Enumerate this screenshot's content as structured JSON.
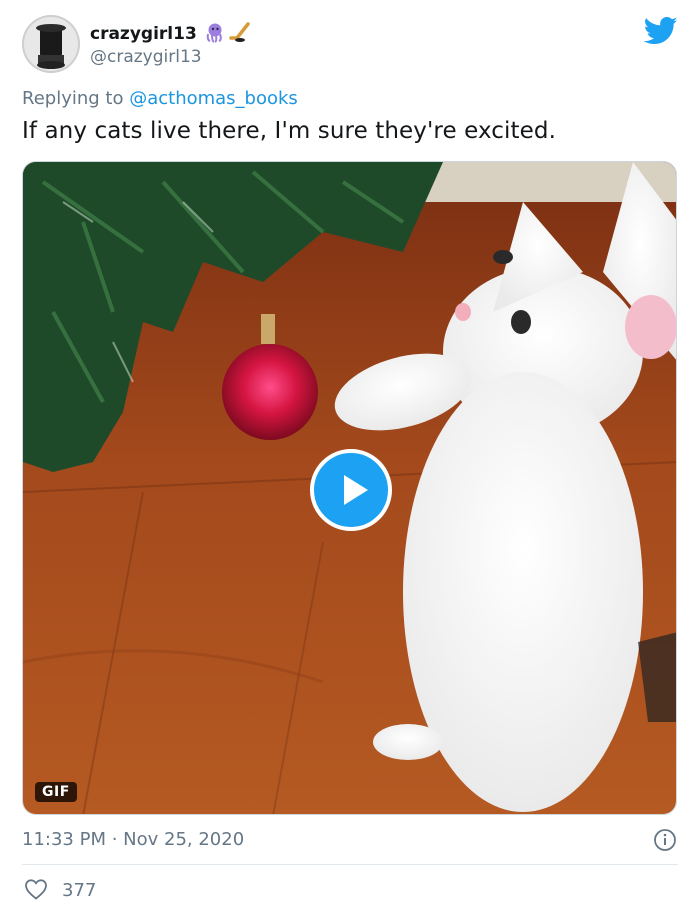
{
  "tweet": {
    "display_name": "crazygirl13",
    "handle": "@crazygirl13",
    "replying_prefix": "Replying to ",
    "replying_to": "@acthomas_books",
    "text": "If any cats live there, I'm sure they're excited.",
    "media_badge": "GIF",
    "timestamp": "11:33 PM · Nov 25, 2020",
    "like_count": "377"
  },
  "icons": {
    "brand": "twitter-bird-icon",
    "play": "play-icon",
    "info": "info-icon",
    "like": "heart-icon",
    "name_emojis": [
      "octopus-emoji",
      "hockey-emoji"
    ]
  },
  "colors": {
    "brand_blue": "#1da1f2",
    "link_blue": "#1b95e0",
    "secondary_text": "#657786",
    "primary_text": "#14171a"
  }
}
